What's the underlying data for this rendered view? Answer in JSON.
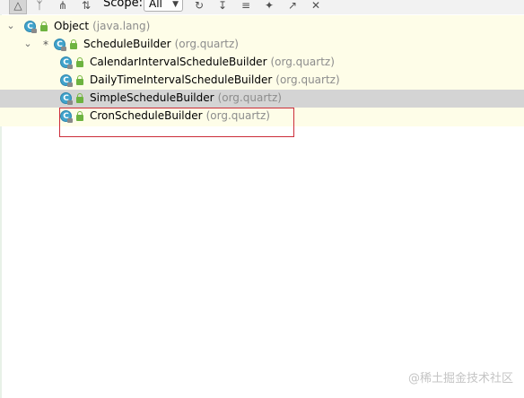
{
  "toolbar": {
    "scope_label": "Scope:",
    "scope_value": "All",
    "icons": [
      "hierarchy-icon",
      "supertypes-icon",
      "subtypes-icon",
      "sort-alpha-icon",
      "refresh-icon",
      "expand-icon",
      "collapse-icon",
      "pin-icon",
      "export-icon",
      "close-icon"
    ]
  },
  "tree": {
    "rows": [
      {
        "name": "Object",
        "package": "(java.lang)",
        "expanded": true,
        "star": false
      },
      {
        "name": "ScheduleBuilder",
        "package": "(org.quartz)",
        "expanded": true,
        "star": true
      },
      {
        "name": "CalendarIntervalScheduleBuilder",
        "package": "(org.quartz)",
        "expanded": false,
        "star": false
      },
      {
        "name": "DailyTimeIntervalScheduleBuilder",
        "package": "(org.quartz)",
        "expanded": false,
        "star": false
      },
      {
        "name": "SimpleScheduleBuilder",
        "package": "(org.quartz)",
        "expanded": false,
        "star": false,
        "selected": true
      },
      {
        "name": "CronScheduleBuilder",
        "package": "(org.quartz)",
        "expanded": false,
        "star": false,
        "highlighted": true
      }
    ]
  },
  "class_icon_letter": "C",
  "colors": {
    "class_icon": "#40a3cc",
    "highlight_border": "#cc2d3a",
    "selected_row": "#d4d4d4",
    "tree_background": "#fefde8"
  },
  "watermark": "@稀土掘金技术社区"
}
